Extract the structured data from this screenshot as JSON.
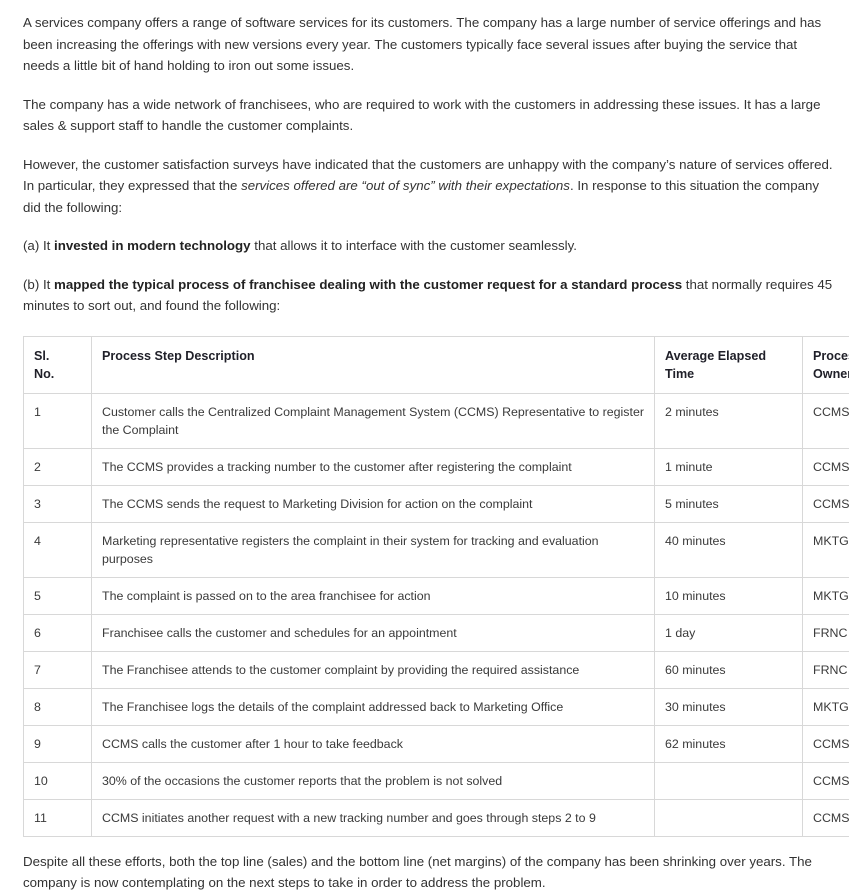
{
  "document": {
    "paragraphs": [
      {
        "id": "intro",
        "runs": [
          {
            "style": "normal",
            "text": "A services company offers a range of software services for its customers. The company has a large number of service offerings and has been increasing the offerings with new versions every year. The customers typically face several issues after buying the service that needs a little bit of hand holding to iron out some issues."
          }
        ]
      },
      {
        "id": "franchisees",
        "runs": [
          {
            "style": "normal",
            "text": "The company has a wide network of franchisees, who are required to work with the customers in addressing these issues. It has a large sales & support staff to handle the customer complaints."
          }
        ]
      },
      {
        "id": "surveys",
        "runs": [
          {
            "style": "normal",
            "text": "However, the customer satisfaction surveys have indicated that the customers are unhappy with the company’s nature of services offered. In particular, they expressed that the "
          },
          {
            "style": "italic",
            "text": "services offered are “out of sync” with their expectations"
          },
          {
            "style": "normal",
            "text": ". In response to this situation the company did the following:"
          }
        ]
      },
      {
        "id": "point-a",
        "runs": [
          {
            "style": "normal",
            "text": "(a) It "
          },
          {
            "style": "bold",
            "text": "invested in modern technology"
          },
          {
            "style": "normal",
            "text": " that allows it to interface with the customer seamlessly."
          }
        ]
      },
      {
        "id": "point-b",
        "runs": [
          {
            "style": "normal",
            "text": "(b) It "
          },
          {
            "style": "bold",
            "text": "mapped the typical process of franchisee dealing with the customer request for a standard process"
          },
          {
            "style": "normal",
            "text": " that normally requires 45 minutes to sort out, and found the following:"
          }
        ]
      }
    ],
    "closing_paragraphs": [
      {
        "id": "closing",
        "runs": [
          {
            "style": "normal",
            "text": "Despite all these efforts, both the top line (sales) and the bottom line (net margins) of the company has been shrinking over years. The company is now contemplating on the next steps to take in order to address the problem."
          }
        ]
      }
    ]
  },
  "table": {
    "headers": {
      "sl_no_line1": "Sl.",
      "sl_no_line2": "No.",
      "description": "Process Step Description",
      "time_line1": "Average Elapsed",
      "time_line2": "Time",
      "owner_line1": "Process",
      "owner_line2": "Owner"
    },
    "rows": [
      {
        "sl_no": "1",
        "description": "Customer calls the Centralized Complaint Management System (CCMS) Representative to register the Complaint",
        "time": "2 minutes",
        "owner": "CCMS",
        "tall": true
      },
      {
        "sl_no": "2",
        "description": "The CCMS provides a tracking number to the customer after registering the complaint",
        "time": "1 minute",
        "owner": "CCMS",
        "tall": false
      },
      {
        "sl_no": "3",
        "description": "The CCMS sends the request to Marketing Division for action on the complaint",
        "time": "5 minutes",
        "owner": "CCMS",
        "tall": false
      },
      {
        "sl_no": "4",
        "description": "Marketing representative registers the complaint in their system for tracking and evaluation purposes",
        "time": "40 minutes",
        "owner": "MKTG",
        "tall": false
      },
      {
        "sl_no": "5",
        "description": "The complaint is passed on to the area franchisee for action",
        "time": "10 minutes",
        "owner": "MKTG",
        "tall": false
      },
      {
        "sl_no": "6",
        "description": "Franchisee calls the customer and schedules for an appointment",
        "time": "1 day",
        "owner": "FRNC",
        "tall": false
      },
      {
        "sl_no": "7",
        "description": "The Franchisee attends to the customer complaint by providing the required assistance",
        "time": "60 minutes",
        "owner": "FRNC",
        "tall": false
      },
      {
        "sl_no": "8",
        "description": "The Franchisee logs the details of the complaint addressed back to Marketing Office",
        "time": "30 minutes",
        "owner": "MKTG",
        "tall": false
      },
      {
        "sl_no": "9",
        "description": "CCMS calls the customer after 1 hour to take feedback",
        "time": "62  minutes",
        "owner": "CCMS",
        "tall": false
      },
      {
        "sl_no": "10",
        "description": "30% of the occasions the customer reports that the problem is not solved",
        "time": "",
        "owner": "CCMS",
        "tall": false
      },
      {
        "sl_no": "11",
        "description": "CCMS initiates another request with a new tracking number and goes through steps 2 to 9",
        "time": "",
        "owner": "CCMS",
        "tall": false
      }
    ]
  },
  "colors": {
    "body_text": "#333333",
    "heading_text": "#1f1f28",
    "table_border": "#d8d8d8",
    "page_background": "#ffffff"
  }
}
